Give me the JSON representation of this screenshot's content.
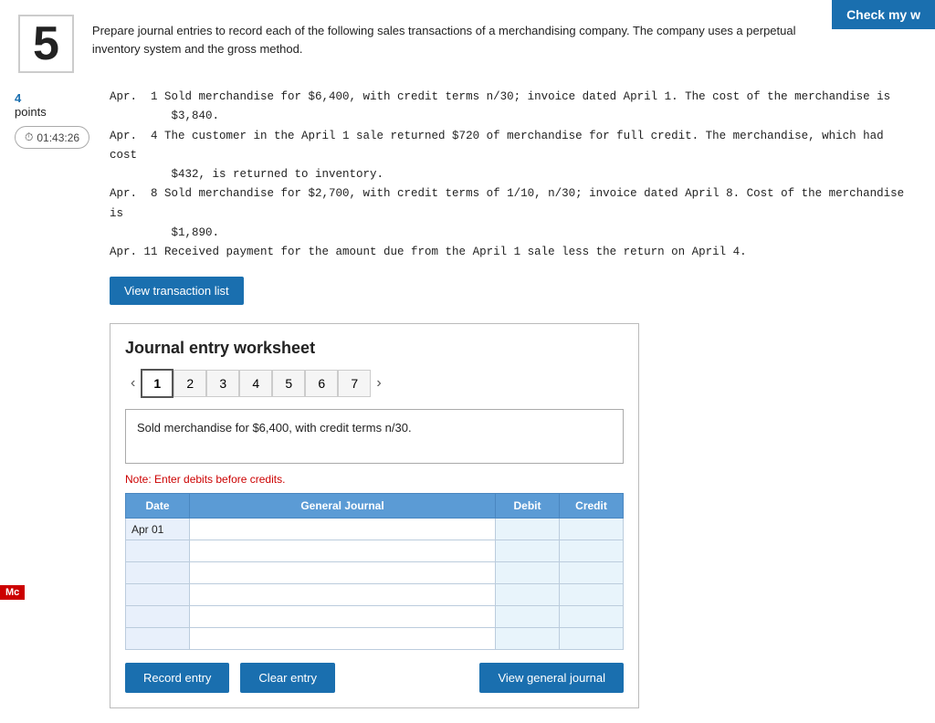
{
  "topbar": {
    "label": "Check my w"
  },
  "question": {
    "number": "5",
    "text": "Prepare journal entries to record each of the following sales transactions of a merchandising company. The company uses a perpetual inventory system and the gross method."
  },
  "sidebar": {
    "points_value": "4",
    "points_label": "points",
    "timer": "01:43:26",
    "timer_icon": "⏱"
  },
  "transactions": [
    "Apr.  1 Sold merchandise for $6,400, with credit terms n/30; invoice dated April 1. The cost of the merchandise is",
    "         $3,840.",
    "Apr.  4 The customer in the April 1 sale returned $720 of merchandise for full credit. The merchandise, which had cost",
    "         $432, is returned to inventory.",
    "Apr.  8 Sold merchandise for $2,700, with credit terms of 1/10, n/30; invoice dated April 8. Cost of the merchandise is",
    "         $1,890.",
    "Apr. 11 Received payment for the amount due from the April 1 sale less the return on April 4."
  ],
  "view_transaction_btn": "View transaction list",
  "worksheet": {
    "title": "Journal entry worksheet",
    "tabs": [
      "1",
      "2",
      "3",
      "4",
      "5",
      "6",
      "7"
    ],
    "active_tab": 0,
    "description": "Sold merchandise for $6,400, with credit terms n/30.",
    "note": "Note: Enter debits before credits.",
    "table": {
      "headers": [
        "Date",
        "General Journal",
        "Debit",
        "Credit"
      ],
      "rows": [
        {
          "date": "Apr 01",
          "gj": "",
          "debit": "",
          "credit": ""
        },
        {
          "date": "",
          "gj": "",
          "debit": "",
          "credit": ""
        },
        {
          "date": "",
          "gj": "",
          "debit": "",
          "credit": ""
        },
        {
          "date": "",
          "gj": "",
          "debit": "",
          "credit": ""
        },
        {
          "date": "",
          "gj": "",
          "debit": "",
          "credit": ""
        },
        {
          "date": "",
          "gj": "",
          "debit": "",
          "credit": ""
        }
      ]
    },
    "buttons": {
      "record": "Record entry",
      "clear": "Clear entry",
      "view_journal": "View general journal"
    }
  },
  "mc_badge": "Mc"
}
